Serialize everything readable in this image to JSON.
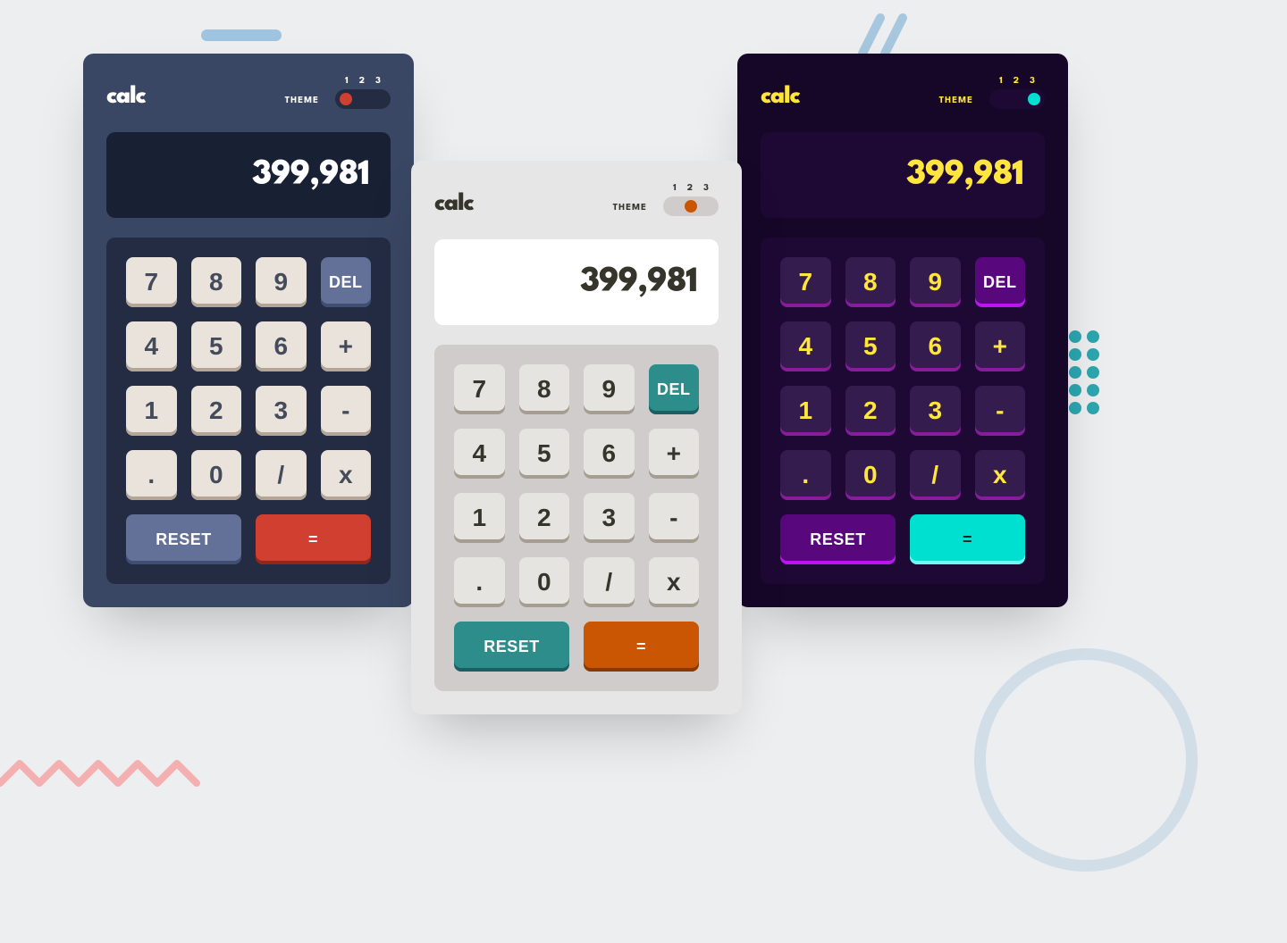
{
  "decor": {
    "deco": true
  },
  "themes": {
    "label": "THEME",
    "nums": [
      "1",
      "2",
      "3"
    ]
  },
  "logo": "calc",
  "display_value": "399,981",
  "keys": {
    "k7": "7",
    "k8": "8",
    "k9": "9",
    "del": "DEL",
    "k4": "4",
    "k5": "5",
    "k6": "6",
    "plus": "+",
    "k1": "1",
    "k2": "2",
    "k3": "3",
    "minus": "-",
    "dot": ".",
    "k0": "0",
    "slash": "/",
    "times": "x",
    "reset": "RESET",
    "eq": "="
  },
  "calculators": [
    {
      "theme_class": "t1",
      "active_theme": 1
    },
    {
      "theme_class": "t2",
      "active_theme": 2
    },
    {
      "theme_class": "t3",
      "active_theme": 3
    }
  ]
}
